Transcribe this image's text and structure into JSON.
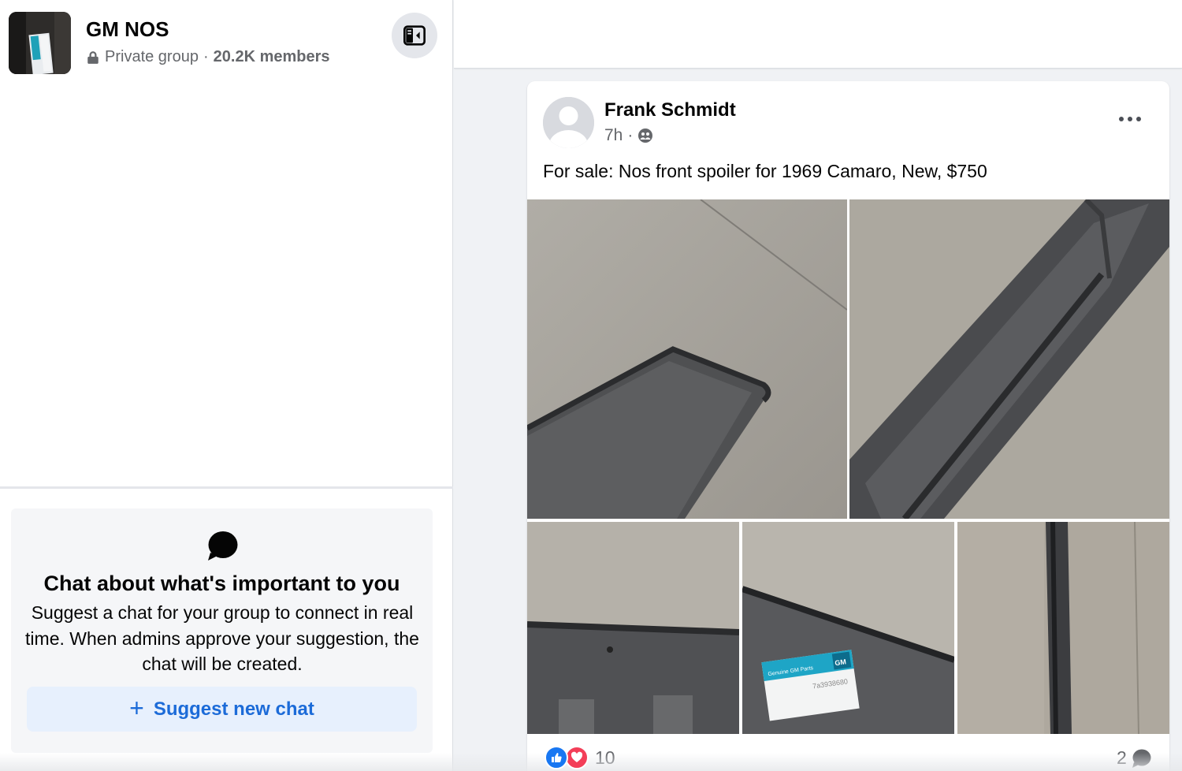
{
  "group": {
    "name": "GM NOS",
    "privacy": "Private group",
    "separator": "·",
    "members": "20.2K members"
  },
  "chat_prompt": {
    "title": "Chat about what's important to you",
    "description": "Suggest a chat for your group to connect in real time. When admins approve your suggestion, the chat will be created.",
    "button_plus": "+",
    "button_label": "Suggest new chat"
  },
  "post": {
    "author": "Frank Schmidt",
    "time": "7h",
    "separator": "·",
    "audience_icon": "group-audience-icon",
    "text": "For sale: Nos front spoiler for 1969 Camaro, New, $750",
    "photos": [
      "photo-1",
      "photo-2",
      "photo-3",
      "photo-4",
      "photo-5"
    ],
    "label_sticker": {
      "brand": "GM",
      "title": "Genuine GM Parts",
      "part_number": "7a3938680"
    },
    "reaction_count": "10",
    "comment_count": "2"
  },
  "colors": {
    "accent": "#1c6bd8",
    "like": "#1877f2",
    "love": "#f33e58",
    "secondary_text": "#65676b"
  }
}
